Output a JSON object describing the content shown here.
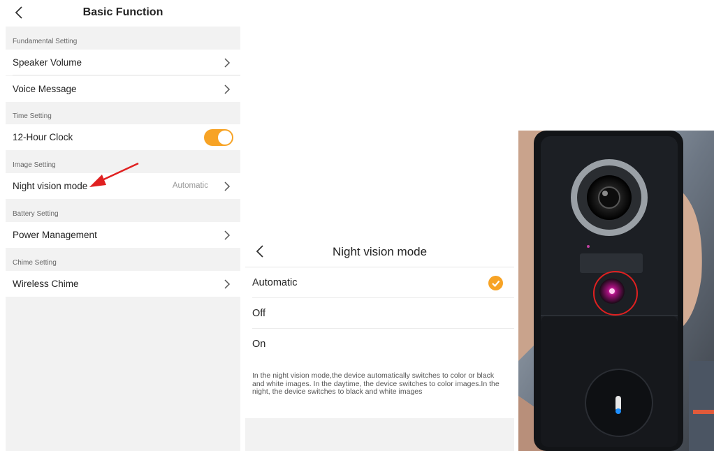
{
  "basic_function": {
    "title": "Basic Function",
    "sections": [
      {
        "label": "Fundamental Setting",
        "rows": [
          {
            "label": "Speaker Volume"
          },
          {
            "label": "Voice Message"
          }
        ]
      },
      {
        "label": "Time Setting",
        "rows": [
          {
            "label": "12-Hour Clock",
            "toggle_on": true
          }
        ]
      },
      {
        "label": "Image Setting",
        "rows": [
          {
            "label": "Night vision mode",
            "value": "Automatic"
          }
        ]
      },
      {
        "label": "Battery Setting",
        "rows": [
          {
            "label": "Power Management"
          }
        ]
      },
      {
        "label": "Chime Setting",
        "rows": [
          {
            "label": "Wireless Chime"
          }
        ]
      }
    ]
  },
  "night_vision": {
    "title": "Night vision mode",
    "options": [
      {
        "label": "Automatic",
        "selected": true
      },
      {
        "label": "Off",
        "selected": false
      },
      {
        "label": "On",
        "selected": false
      }
    ],
    "description": "In the night vision mode,the device automatically switches to color or black and white images. In the daytime, the device switches to color images.In the night, the device switches to black and white images"
  },
  "colors": {
    "accent": "#f7a325",
    "annotation": "#e02020",
    "background": "#f2f2f2"
  },
  "icons": [
    "back-chevron-icon",
    "chevron-right-icon",
    "check-icon",
    "toggle-switch"
  ]
}
